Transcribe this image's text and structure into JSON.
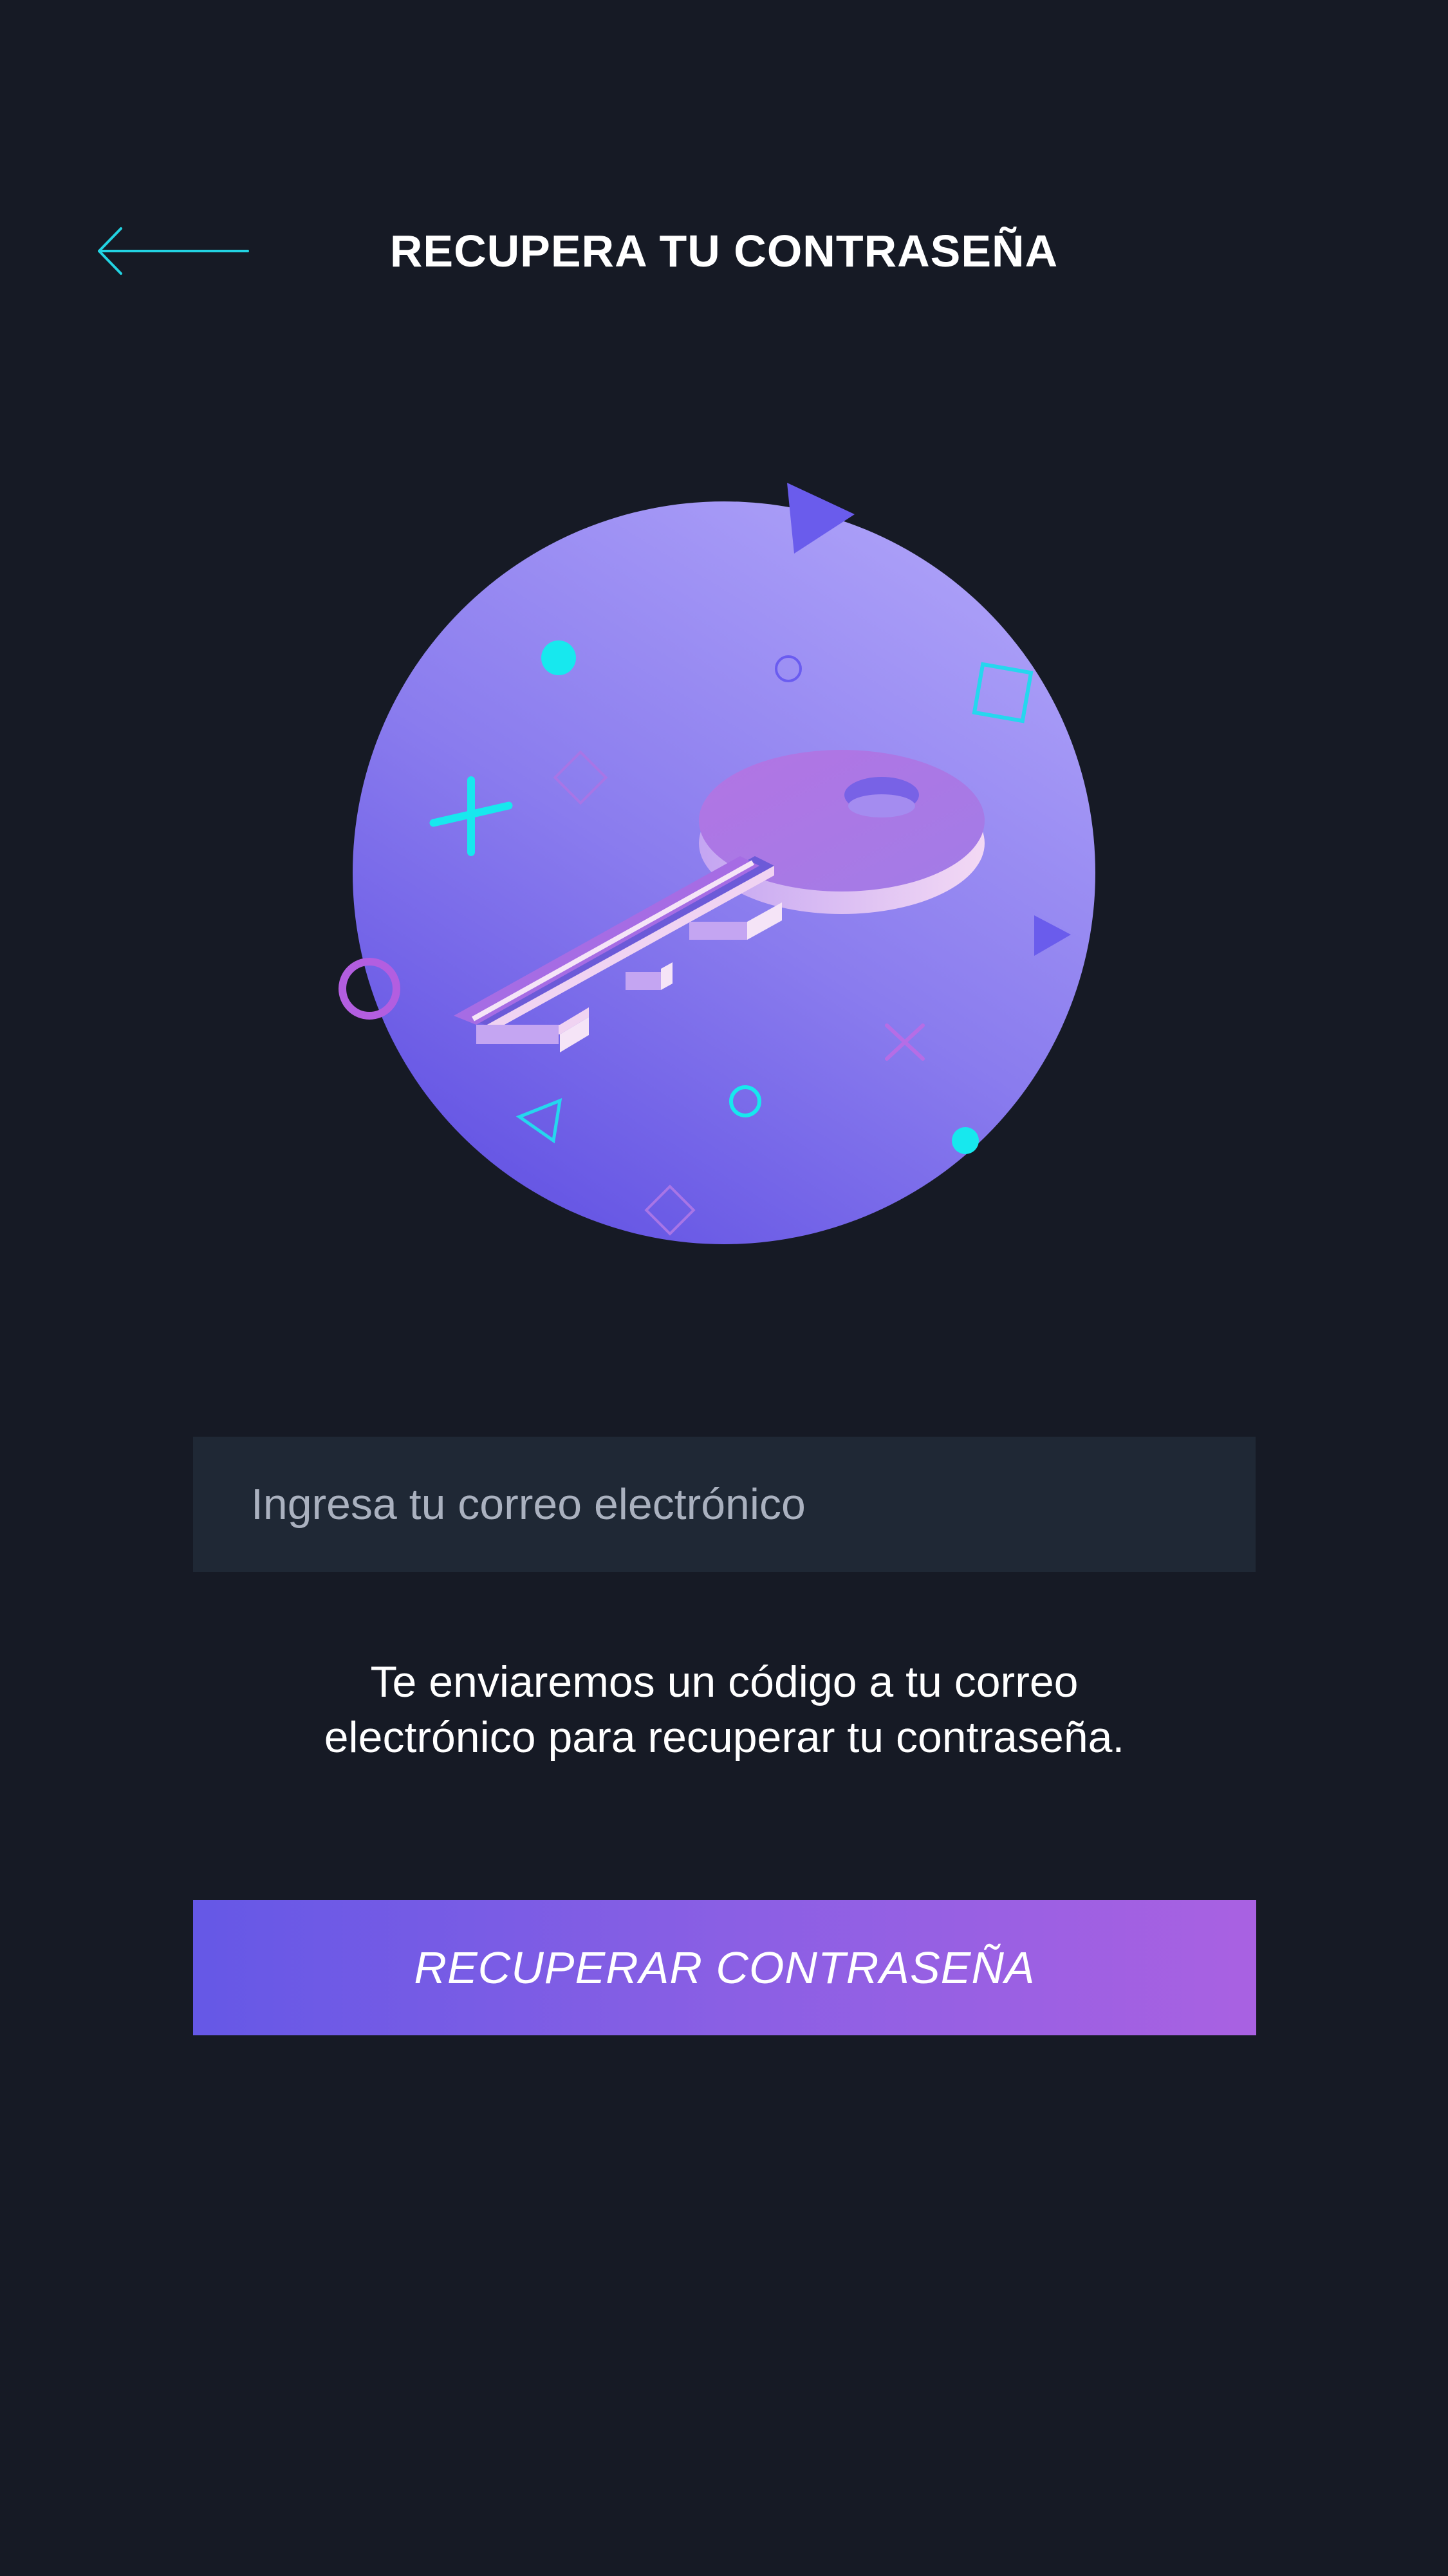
{
  "header": {
    "title": "RECUPERA TU CONTRASEÑA",
    "back_icon": "arrow-left-icon"
  },
  "illustration": {
    "icon": "key-icon",
    "colors": {
      "circle_light": "#a99cf7",
      "circle_dark": "#6a58e5",
      "key": "#b67ee6",
      "accent_cyan": "#17e8ee",
      "accent_purple": "#6a5cf0"
    }
  },
  "form": {
    "email_placeholder": "Ingresa tu correo electrónico",
    "email_value": ""
  },
  "helper": {
    "line1": "Te enviaremos un código a tu correo",
    "line2": "electrónico para recuperar tu contraseña."
  },
  "submit": {
    "label": "RECUPERAR CONTRASEÑA"
  },
  "colors": {
    "background": "#161a25",
    "input_background": "#1f2835",
    "accent": "#22d3e2",
    "button_gradient_start": "#6558e6",
    "button_gradient_end": "#a961e2"
  }
}
